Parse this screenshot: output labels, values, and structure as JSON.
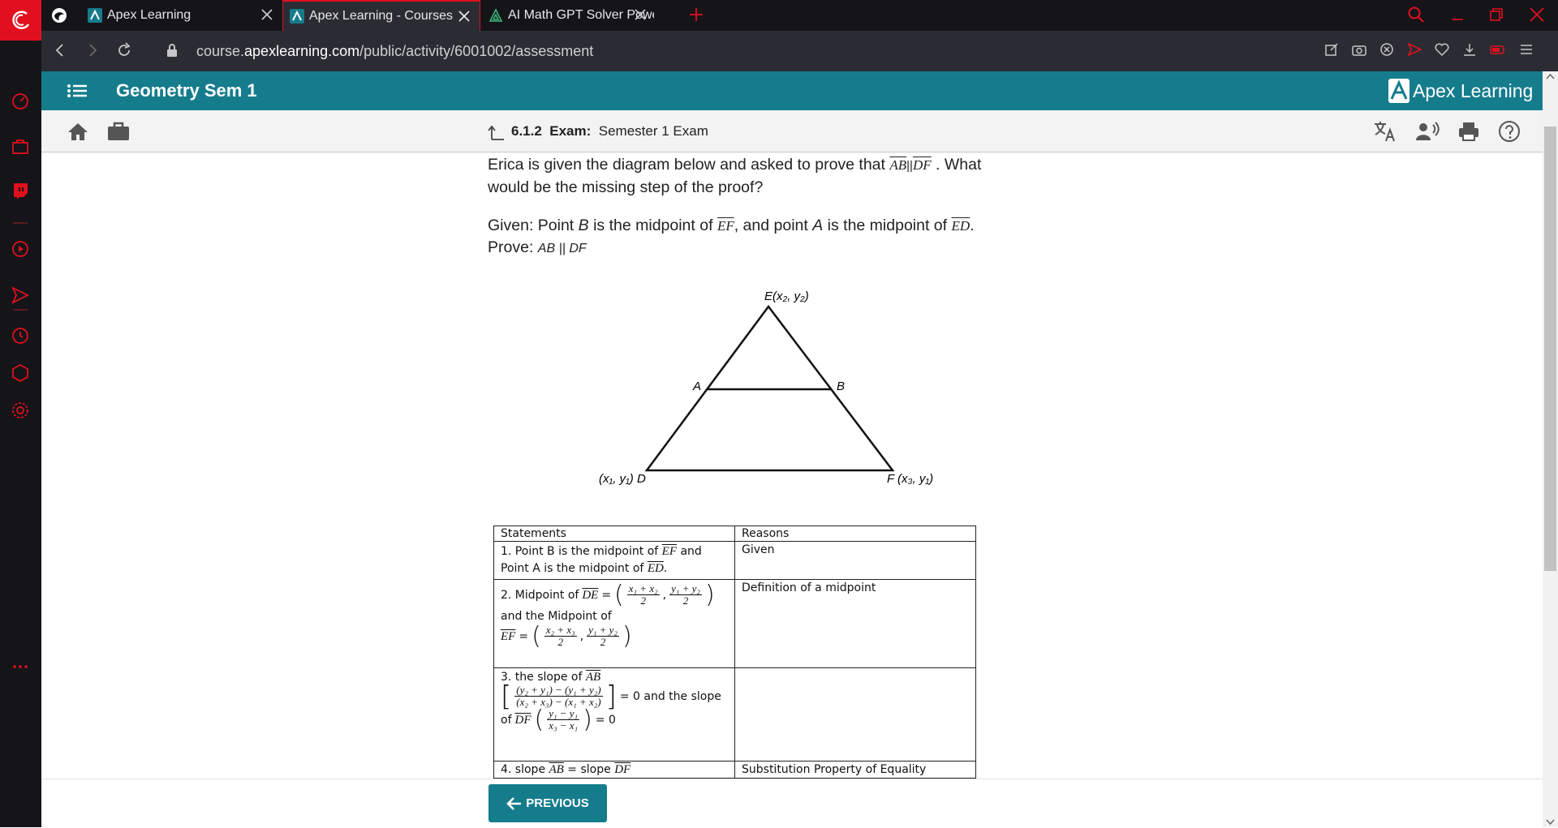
{
  "browser": {
    "tabs": [
      {
        "label": "Apex Learning",
        "active": false
      },
      {
        "label": "Apex Learning - Courses",
        "active": true
      },
      {
        "label": "AI Math GPT Solver Powere",
        "active": false
      }
    ],
    "url_prefix": "course.",
    "url_domain": "apexlearning.com",
    "url_path": "/public/activity/6001002/assessment",
    "accent": "#e1101e"
  },
  "app": {
    "course_title": "Geometry Sem 1",
    "brand": "Apex Learning",
    "header_color": "#157c8c"
  },
  "breadcrumb": {
    "number": "6.1.2",
    "type": "Exam:",
    "title": "Semester 1 Exam"
  },
  "question": {
    "intro_1": "Erica is given the diagram below and asked to prove that",
    "seg_ab": "AB",
    "parallel": "||",
    "seg_df": "DF",
    "intro_2": ". What would be the missing step of the proof?",
    "given_1": "Given: Point",
    "given_b": "B",
    "given_2": "is the midpoint of",
    "seg_ef": "EF",
    "given_3": ", and point",
    "given_a": "A",
    "given_4": "is the midpoint of",
    "seg_ed": "ED",
    "given_5": ".",
    "prove_label": "Prove:",
    "prove_stmt": "AB || DF"
  },
  "diagram": {
    "label_e": "E(x₂, y₂)",
    "label_a": "A",
    "label_b": "B",
    "label_d": "(x₁, y₁) D",
    "label_f": "F (x₃, y₁)"
  },
  "proof_table": {
    "headers": [
      "Statements",
      "Reasons"
    ],
    "row1_stmt_a": "1. Point B is the midpoint of",
    "row1_ef": "EF",
    "row1_stmt_b": "and",
    "row1_stmt_c": "Point A is the midpoint of",
    "row1_ed": "ED",
    "row1_stmt_d": ".",
    "row1_reason": "Given",
    "row2_stmt_a": "2. Midpoint of",
    "row2_de": "DE",
    "row2_f1_num": "x₁ + x₂",
    "row2_f1_den": "2",
    "row2_f2_num": "y₁ + y₂",
    "row2_f2_den": "2",
    "row2_stmt_b": "and the Midpoint of",
    "row2_ef": "EF",
    "row2_f3_num": "x₂ + x₃",
    "row2_f3_den": "2",
    "row2_f4_num": "y₁ + y₂",
    "row2_f4_den": "2",
    "row2_reason": "Definition of a midpoint",
    "row3_stmt_a": "3. the slope of",
    "row3_ab": "AB",
    "row3_num": "(y₂ + y₁) − (y₁ + y₂)",
    "row3_den": "(x₂ + x₃) − (x₁ + x₂)",
    "row3_eq": "= 0 and the slope",
    "row3_of": "of",
    "row3_df": "DF",
    "row3_num2": "y₁ − y₁",
    "row3_den2": "x₃ − x₁",
    "row3_eq2": "= 0",
    "row3_reason": "",
    "row4_stmt_a": "4. slope",
    "row4_ab": "AB",
    "row4_stmt_b": "= slope",
    "row4_df": "DF",
    "row4_reason": "Substitution Property of Equality"
  },
  "footer": {
    "previous_label": "PREVIOUS"
  }
}
